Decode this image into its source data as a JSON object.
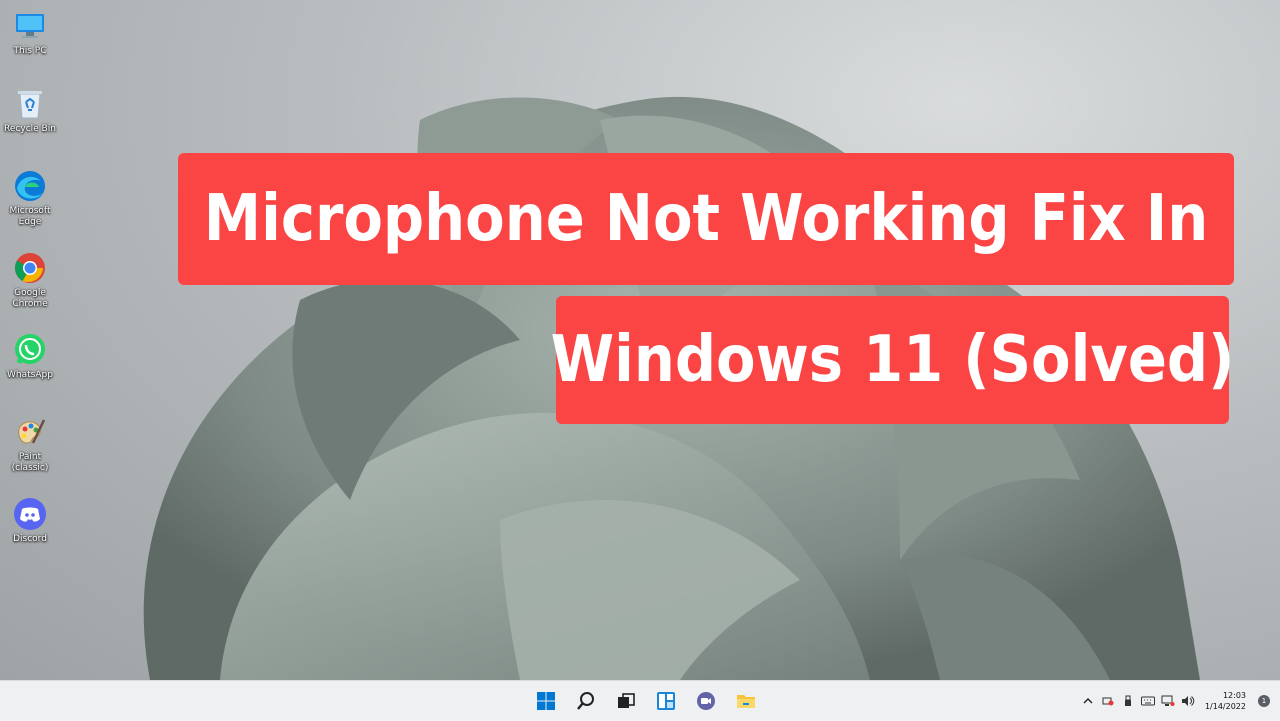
{
  "desktop_icons": [
    {
      "name": "this-pc",
      "label": "This PC",
      "icon": "monitor-icon"
    },
    {
      "name": "recycle-bin",
      "label": "Recycle Bin",
      "icon": "recycle-bin-icon"
    },
    {
      "name": "microsoft-edge",
      "label": "Microsoft Edge",
      "icon": "edge-icon"
    },
    {
      "name": "google-chrome",
      "label": "Google Chrome",
      "icon": "chrome-icon"
    },
    {
      "name": "whatsapp",
      "label": "WhatsApp",
      "icon": "whatsapp-icon"
    },
    {
      "name": "paint-classic",
      "label": "Paint (classic)",
      "icon": "paint-palette-icon"
    },
    {
      "name": "discord",
      "label": "Discord",
      "icon": "discord-icon"
    }
  ],
  "title": {
    "line1": "Microphone Not Working Fix In",
    "line2": "Windows 11 (Solved)",
    "banner_color": "#fb4545"
  },
  "taskbar": {
    "apps": [
      "windows-start-icon",
      "search-icon",
      "task-view-icon",
      "widgets-icon",
      "teams-chat-icon",
      "file-explorer-icon"
    ],
    "clock": {
      "time": "12:03",
      "date": "1/14/2022"
    },
    "notification_count": "1"
  }
}
